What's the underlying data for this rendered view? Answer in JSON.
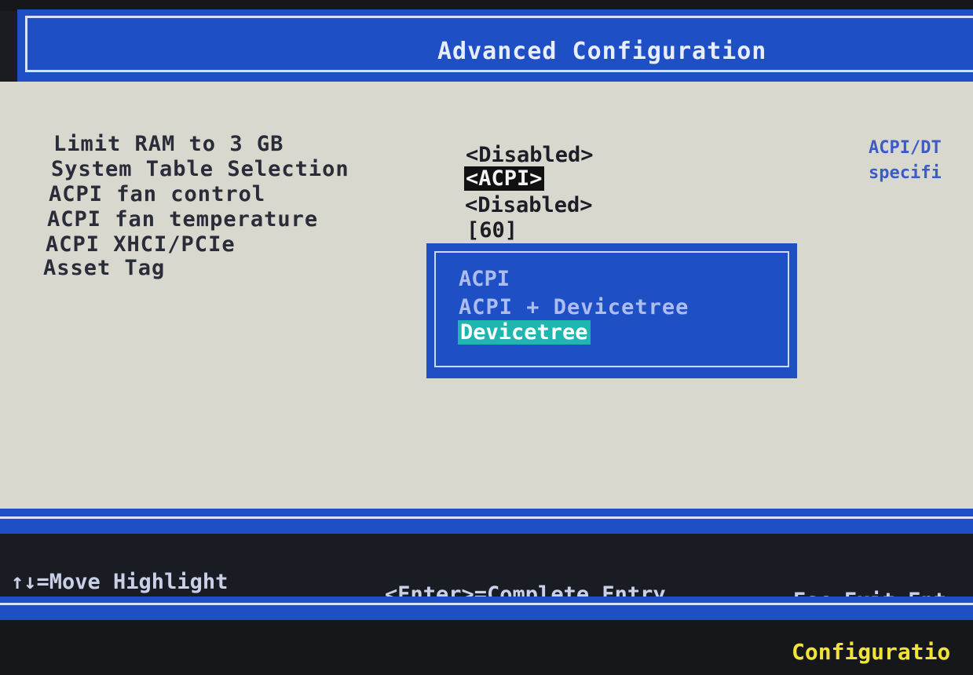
{
  "header": {
    "title": "Advanced Configuration"
  },
  "settings": [
    {
      "label": "Limit RAM to 3 GB",
      "value": "<Disabled>"
    },
    {
      "label": "System Table Selection",
      "value": "<ACPI>"
    },
    {
      "label": "ACPI fan control",
      "value": "<Disabled>"
    },
    {
      "label": "ACPI fan temperature",
      "value": "[60]"
    },
    {
      "label": "ACPI XHCI/PCIe",
      "value": ""
    },
    {
      "label": "Asset Tag",
      "value": ""
    }
  ],
  "help": {
    "line1": "ACPI/DT",
    "line2": "specifi"
  },
  "popup": {
    "options": [
      "ACPI",
      "ACPI + Devicetree",
      "Devicetree"
    ],
    "highlighted": "Devicetree"
  },
  "footer": {
    "move": "↑↓=Move Highlight",
    "enter": "<Enter>=Complete Entry",
    "esc": "Esc=Exit Ent"
  },
  "status": {
    "text": "Configuratio"
  },
  "colors": {
    "panel_blue": "#1e4fc4",
    "content_bg": "#d9d8cf",
    "highlight_cyan": "#1fb6b0",
    "status_yellow": "#f2e33a"
  }
}
